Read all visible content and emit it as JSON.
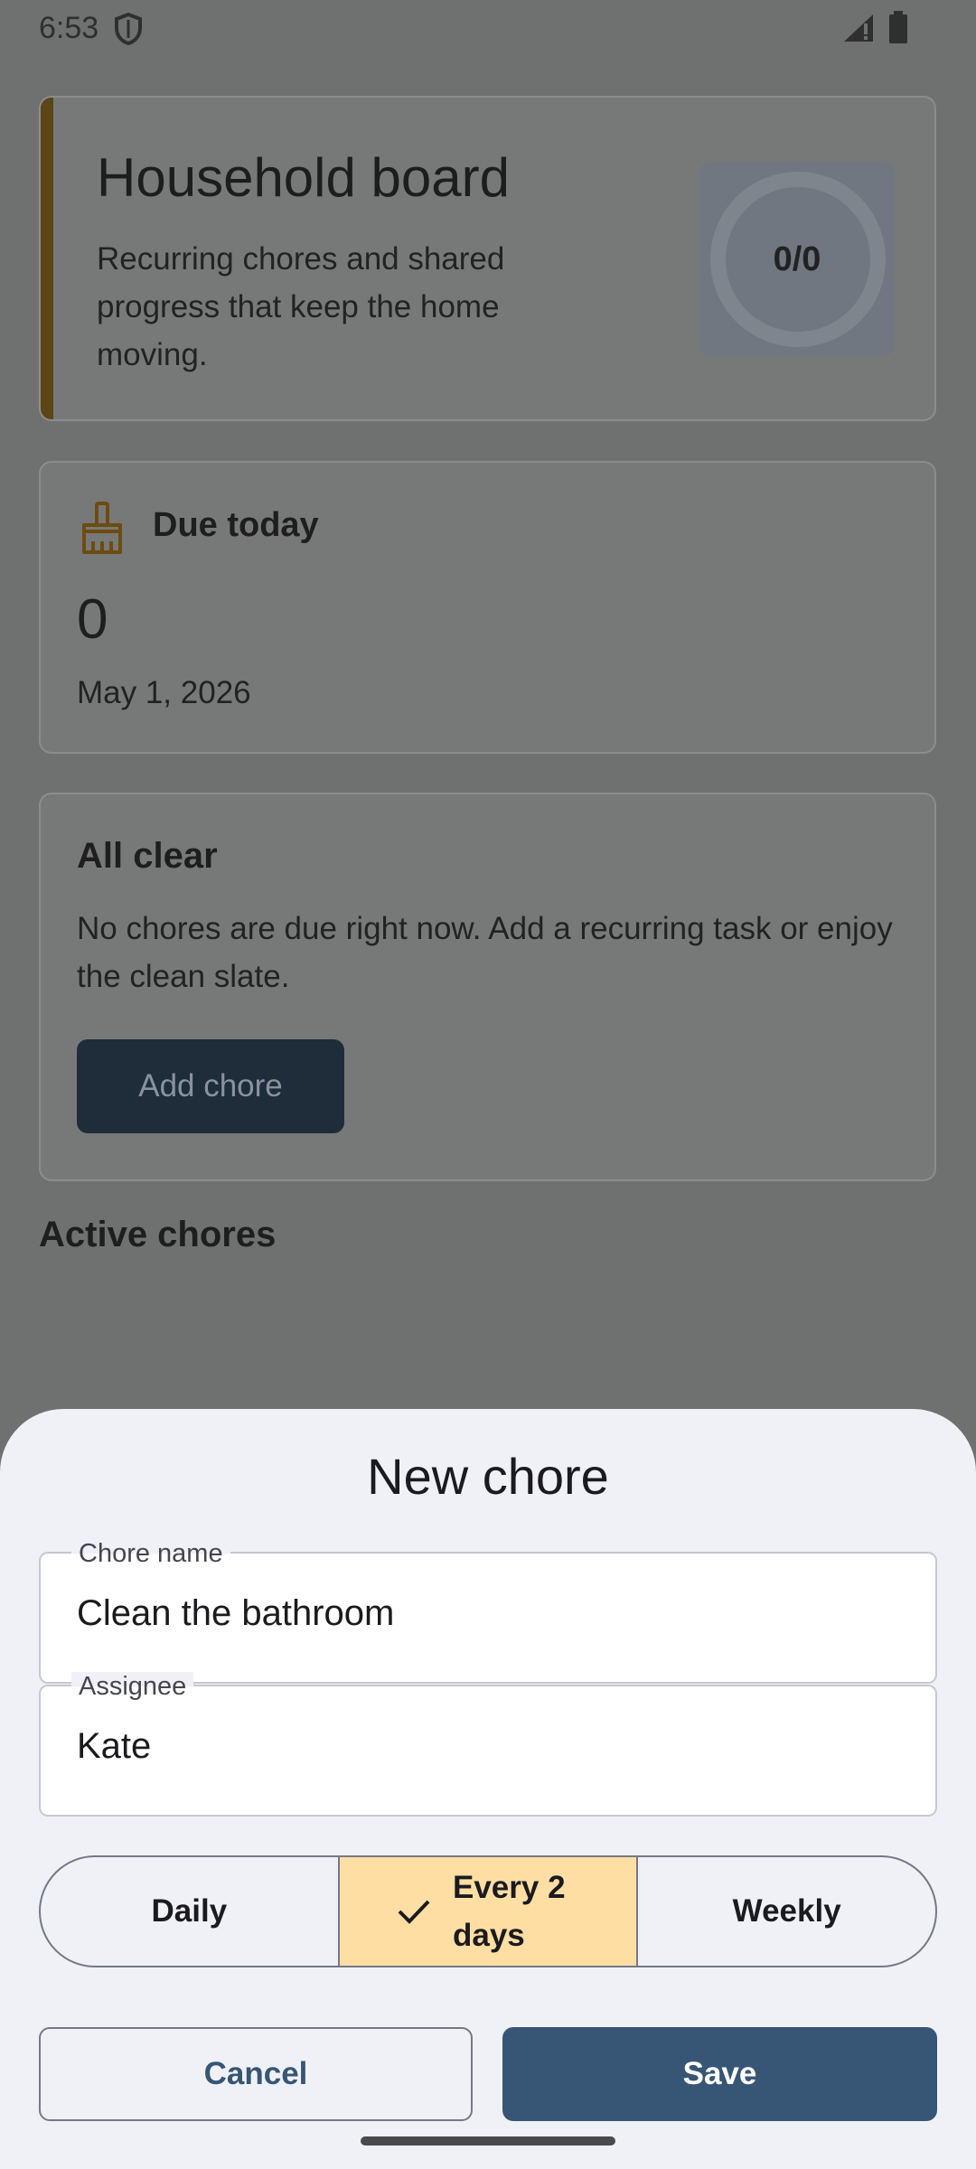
{
  "status_bar": {
    "time": "6:53",
    "icons": [
      "shield-icon",
      "signal-icon",
      "battery-icon"
    ]
  },
  "background_screen": {
    "hero": {
      "title": "Household board",
      "subtitle": "Recurring chores and shared progress that keep the home moving.",
      "progress_text": "0/0",
      "accent_color": "#5c4516"
    },
    "due_today": {
      "icon": "broom-icon",
      "label": "Due today",
      "count": "0",
      "date": "May 1, 2026"
    },
    "all_clear": {
      "title": "All clear",
      "body": "No chores are due right now. Add a recurring task or enjoy the clean slate.",
      "button_label": "Add chore"
    },
    "active_chores_heading": "Active chores"
  },
  "sheet": {
    "title": "New chore",
    "fields": [
      {
        "label": "Chore name",
        "value": "Clean the bathroom"
      },
      {
        "label": "Assignee",
        "value": "Kate"
      }
    ],
    "frequency": {
      "options": [
        "Daily",
        "Every 2 days",
        "Weekly"
      ],
      "selected": "Every 2 days",
      "selected_color": "#ffdea4"
    },
    "cancel_label": "Cancel",
    "save_label": "Save",
    "primary_color": "#375675"
  }
}
